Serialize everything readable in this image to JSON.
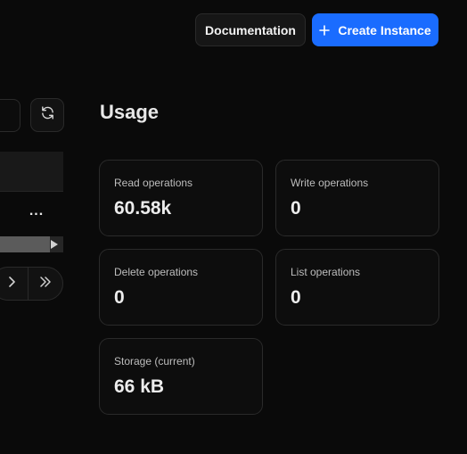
{
  "header": {
    "documentation_label": "Documentation",
    "create_instance_label": "Create Instance"
  },
  "left_panel": {
    "row_more": "..."
  },
  "usage": {
    "title": "Usage",
    "cards": [
      {
        "label": "Read operations",
        "value": "60.58k"
      },
      {
        "label": "Write operations",
        "value": "0"
      },
      {
        "label": "Delete operations",
        "value": "0"
      },
      {
        "label": "List operations",
        "value": "0"
      },
      {
        "label": "Storage (current)",
        "value": "66 kB"
      }
    ]
  },
  "colors": {
    "background": "#0a0a0a",
    "accent": "#1a6cff",
    "card_border": "#2a2a2a"
  },
  "icons": [
    "plus-icon",
    "refresh-icon",
    "more-icon",
    "chevron-right-icon",
    "chevrons-right-icon",
    "scroll-right-arrow-icon"
  ]
}
